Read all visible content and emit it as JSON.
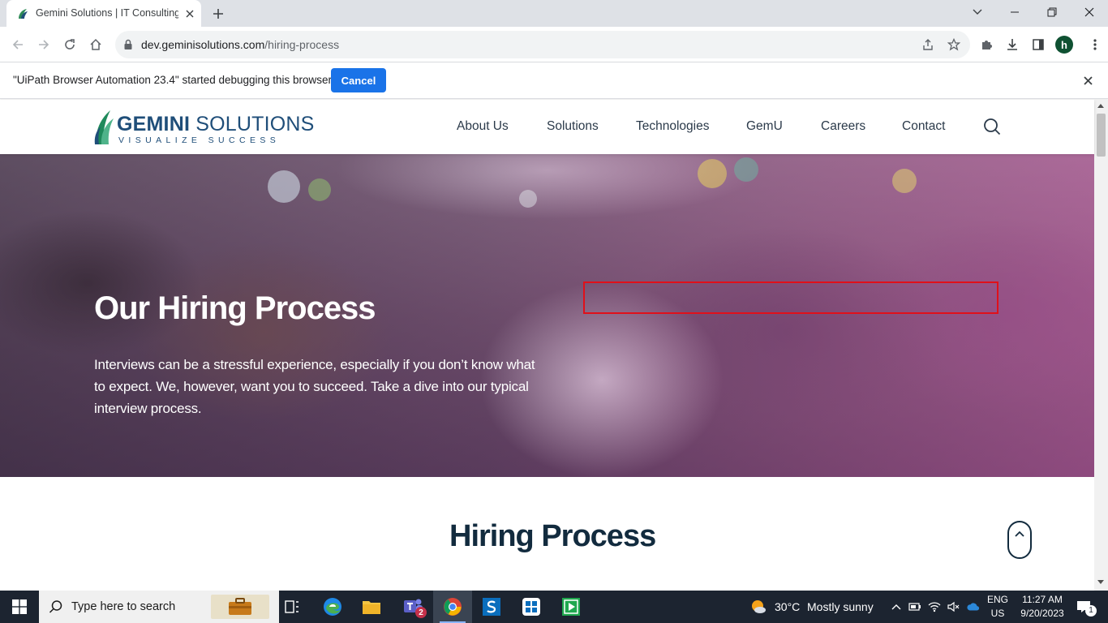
{
  "browser": {
    "tab_title": "Gemini Solutions | IT Consulting",
    "url_host": "dev.geminisolutions.com",
    "url_path": "/hiring-process",
    "profile_initial": "h"
  },
  "infobar": {
    "message": "\"UiPath Browser Automation 23.4\" started debugging this browser",
    "cancel_label": "Cancel"
  },
  "site": {
    "logo_word_1": "GEMINI",
    "logo_word_2": "SOLUTIONS",
    "logo_tagline": "VISUALIZE SUCCESS",
    "nav": [
      "About Us",
      "Solutions",
      "Technologies",
      "GemU",
      "Careers",
      "Contact"
    ]
  },
  "hero": {
    "title": "Our Hiring Process",
    "text": "Interviews can be a stressful experience, especially if you don’t know what to expect. We, however, want you to succeed. Take a dive into our typical interview process."
  },
  "section": {
    "title": "Hiring Process"
  },
  "taskbar": {
    "search_placeholder": "Type here to search",
    "teams_badge": "2",
    "weather_temp": "30°C",
    "weather_desc": "Mostly sunny",
    "lang_1": "ENG",
    "lang_2": "US",
    "time": "11:27 AM",
    "date": "9/20/2023",
    "notification_count": "1"
  },
  "colors": {
    "accent_blue": "#1a73e8",
    "brand_navy": "#1f4e79",
    "highlight_red": "#e0101a",
    "taskbar_bg": "#1c2430"
  }
}
